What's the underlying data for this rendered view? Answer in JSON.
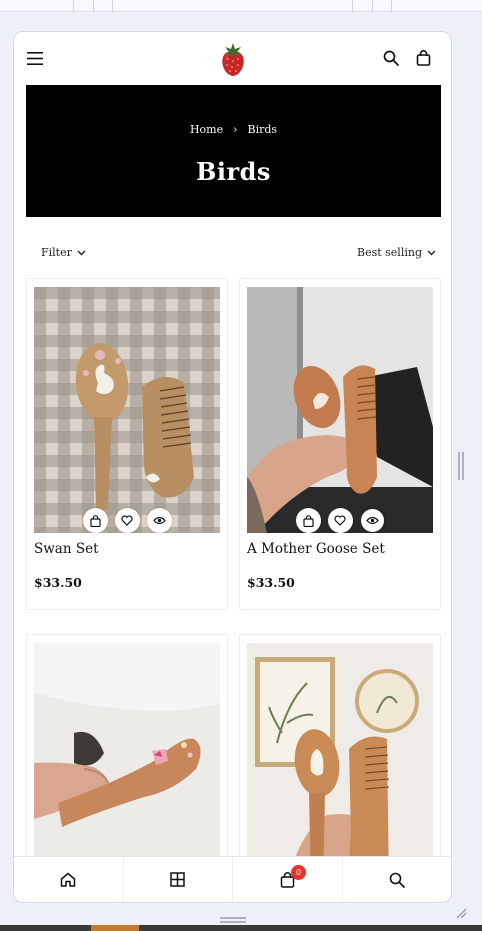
{
  "store": {
    "logo_icon": "strawberry-icon"
  },
  "breadcrumb": {
    "home": "Home",
    "current": "Birds"
  },
  "collection": {
    "title": "Birds"
  },
  "toolbar": {
    "filter_label": "Filter",
    "sort_label": "Best selling"
  },
  "products": [
    {
      "title": "Swan Set",
      "price": "$33.50"
    },
    {
      "title": "A Mother Goose Set",
      "price": "$33.50"
    },
    {
      "title": "",
      "price": ""
    },
    {
      "title": "",
      "price": ""
    }
  ],
  "bottom_nav": {
    "items": [
      "home-icon",
      "grid-icon",
      "cart-icon",
      "search-icon"
    ],
    "cart_count": "0"
  },
  "colors": {
    "hero_bg": "#000000",
    "badge": "#e2342b",
    "accent": "#c27a2c"
  }
}
